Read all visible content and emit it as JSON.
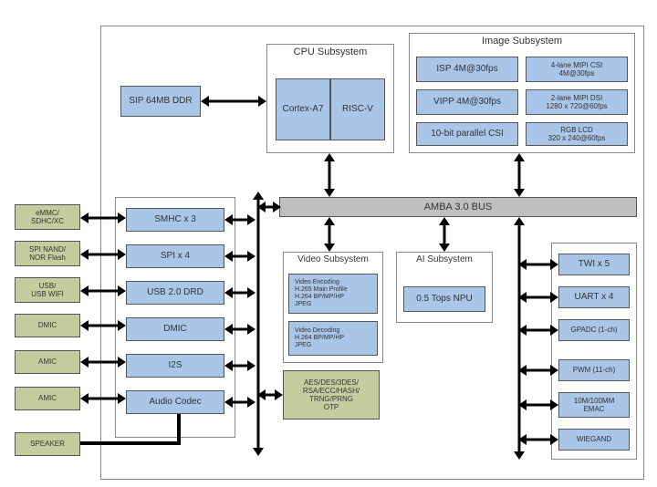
{
  "sip": "SIP 64MB DDR",
  "cpu": {
    "title": "CPU Subsystem",
    "core_a": "Cortex-A7",
    "core_b": "RISC-V"
  },
  "image": {
    "title": "Image Subsystem",
    "isp": "ISP 4M@30fps",
    "vipp": "VIPP 4M@30fps",
    "parallel_csi": "10-bit parallel CSI",
    "mipi_csi": "4-lane MIPI CSI\n4M@30fps",
    "mipi_dsi": "2-lane MIPI DSI\n1280 x 720@60fps",
    "rgb_lcd": "RGB LCD\n320 x 240@60fps"
  },
  "bus": "AMBA 3.0 BUS",
  "video": {
    "title": "Video Subsystem",
    "encoding": "Video Encoding\nH.265 Main Profile\nH.264 BP/MP/HP\nJPEG",
    "decoding": "Video Decoding\nH.264 BP/MP/HP\nJPEG"
  },
  "ai": {
    "title": "AI Subsystem",
    "npu": "0.5 Tops NPU"
  },
  "crypto": "AES/DES/3DES/\nRSA/ECC/HASH/\nTRNG/PRNG\nOTP",
  "left_internal": {
    "smhc": "SMHC x 3",
    "spi": "SPI x 4",
    "usb": "USB 2.0 DRD",
    "dmic": "DMIC",
    "i2s": "I2S",
    "audio": "Audio Codec"
  },
  "left_external": {
    "emmc": "eMMC/\nSDHC/XC",
    "spi_flash": "SPI NAND/\nNOR Flash",
    "usb_wifi": "USB/\nUSB WIFI",
    "dmic": "DMIC",
    "amic1": "AMIC",
    "amic2": "AMIC",
    "speaker": "SPEAKER"
  },
  "right_peripherals": {
    "twi": "TWI x 5",
    "uart": "UART x 4",
    "gpadc": "GPADC (1-ch)",
    "pwm": "PWM (11-ch)",
    "emac": "10M/100MM\nEMAC",
    "wiegand": "WIEGAND"
  }
}
